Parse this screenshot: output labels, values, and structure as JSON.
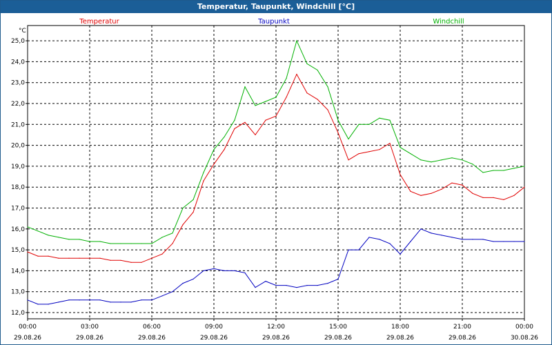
{
  "window": {
    "title": "Temperatur, Taupunkt, Windchill [°C]"
  },
  "chart_data": {
    "type": "line",
    "title": "Temperatur, Taupunkt, Windchill [°C]",
    "ylabel": "°C",
    "ylim": [
      12.0,
      25.0
    ],
    "yticks": [
      "12,0",
      "13,0",
      "14,0",
      "15,0",
      "16,0",
      "17,0",
      "18,0",
      "19,0",
      "20,0",
      "21,0",
      "22,0",
      "23,0",
      "24,0",
      "25,0"
    ],
    "xlim": [
      0,
      24
    ],
    "xticks": [
      {
        "time": "00:00",
        "date": "29.08.26"
      },
      {
        "time": "03:00",
        "date": "29.08.26"
      },
      {
        "time": "06:00",
        "date": "29.08.26"
      },
      {
        "time": "09:00",
        "date": "29.08.26"
      },
      {
        "time": "12:00",
        "date": "29.08.26"
      },
      {
        "time": "15:00",
        "date": "29.08.26"
      },
      {
        "time": "18:00",
        "date": "29.08.26"
      },
      {
        "time": "21:00",
        "date": "29.08.26"
      },
      {
        "time": "00:00",
        "date": "30.08.26"
      }
    ],
    "grid": true,
    "legend_position": "top",
    "x": [
      0,
      0.5,
      1,
      1.5,
      2,
      2.5,
      3,
      3.5,
      4,
      4.5,
      5,
      5.5,
      6,
      6.5,
      7,
      7.5,
      8,
      8.5,
      9,
      9.5,
      10,
      10.5,
      11,
      11.5,
      12,
      12.5,
      13,
      13.5,
      14,
      14.5,
      15,
      15.5,
      16,
      16.5,
      17,
      17.5,
      18,
      18.5,
      19,
      19.5,
      20,
      20.5,
      21,
      21.5,
      22,
      22.5,
      23,
      23.5,
      24
    ],
    "series": [
      {
        "name": "Temperatur",
        "color": "#e00000",
        "values": [
          14.9,
          14.7,
          14.7,
          14.6,
          14.6,
          14.6,
          14.6,
          14.6,
          14.5,
          14.5,
          14.4,
          14.4,
          14.6,
          14.8,
          15.3,
          16.2,
          16.8,
          18.3,
          19.1,
          19.8,
          20.8,
          21.1,
          20.5,
          21.2,
          21.4,
          22.3,
          23.4,
          22.5,
          22.2,
          21.7,
          20.6,
          19.3,
          19.6,
          19.7,
          19.8,
          20.1,
          18.6,
          17.8,
          17.6,
          17.7,
          17.9,
          18.2,
          18.1,
          17.7,
          17.5,
          17.5,
          17.4,
          17.6,
          18.0
        ]
      },
      {
        "name": "Taupunkt",
        "color": "#0000c0",
        "values": [
          12.6,
          12.4,
          12.4,
          12.5,
          12.6,
          12.6,
          12.6,
          12.6,
          12.5,
          12.5,
          12.5,
          12.6,
          12.6,
          12.8,
          13.0,
          13.4,
          13.6,
          14.0,
          14.1,
          14.0,
          14.0,
          13.9,
          13.2,
          13.5,
          13.3,
          13.3,
          13.2,
          13.3,
          13.3,
          13.4,
          13.6,
          15.0,
          15.0,
          15.6,
          15.5,
          15.3,
          14.8,
          15.4,
          16.0,
          15.8,
          15.7,
          15.6,
          15.5,
          15.5,
          15.5,
          15.4,
          15.4,
          15.4,
          15.4
        ]
      },
      {
        "name": "Windchill",
        "color": "#00b000",
        "values": [
          16.1,
          15.9,
          15.7,
          15.6,
          15.5,
          15.5,
          15.4,
          15.4,
          15.3,
          15.3,
          15.3,
          15.3,
          15.3,
          15.6,
          15.8,
          17.0,
          17.4,
          18.7,
          19.8,
          20.4,
          21.2,
          22.8,
          21.9,
          22.1,
          22.3,
          23.2,
          25.0,
          23.9,
          23.6,
          22.8,
          21.2,
          20.3,
          21.0,
          21.0,
          21.3,
          21.2,
          19.9,
          19.6,
          19.3,
          19.2,
          19.3,
          19.4,
          19.3,
          19.1,
          18.7,
          18.8,
          18.8,
          18.9,
          19.0
        ]
      }
    ]
  }
}
